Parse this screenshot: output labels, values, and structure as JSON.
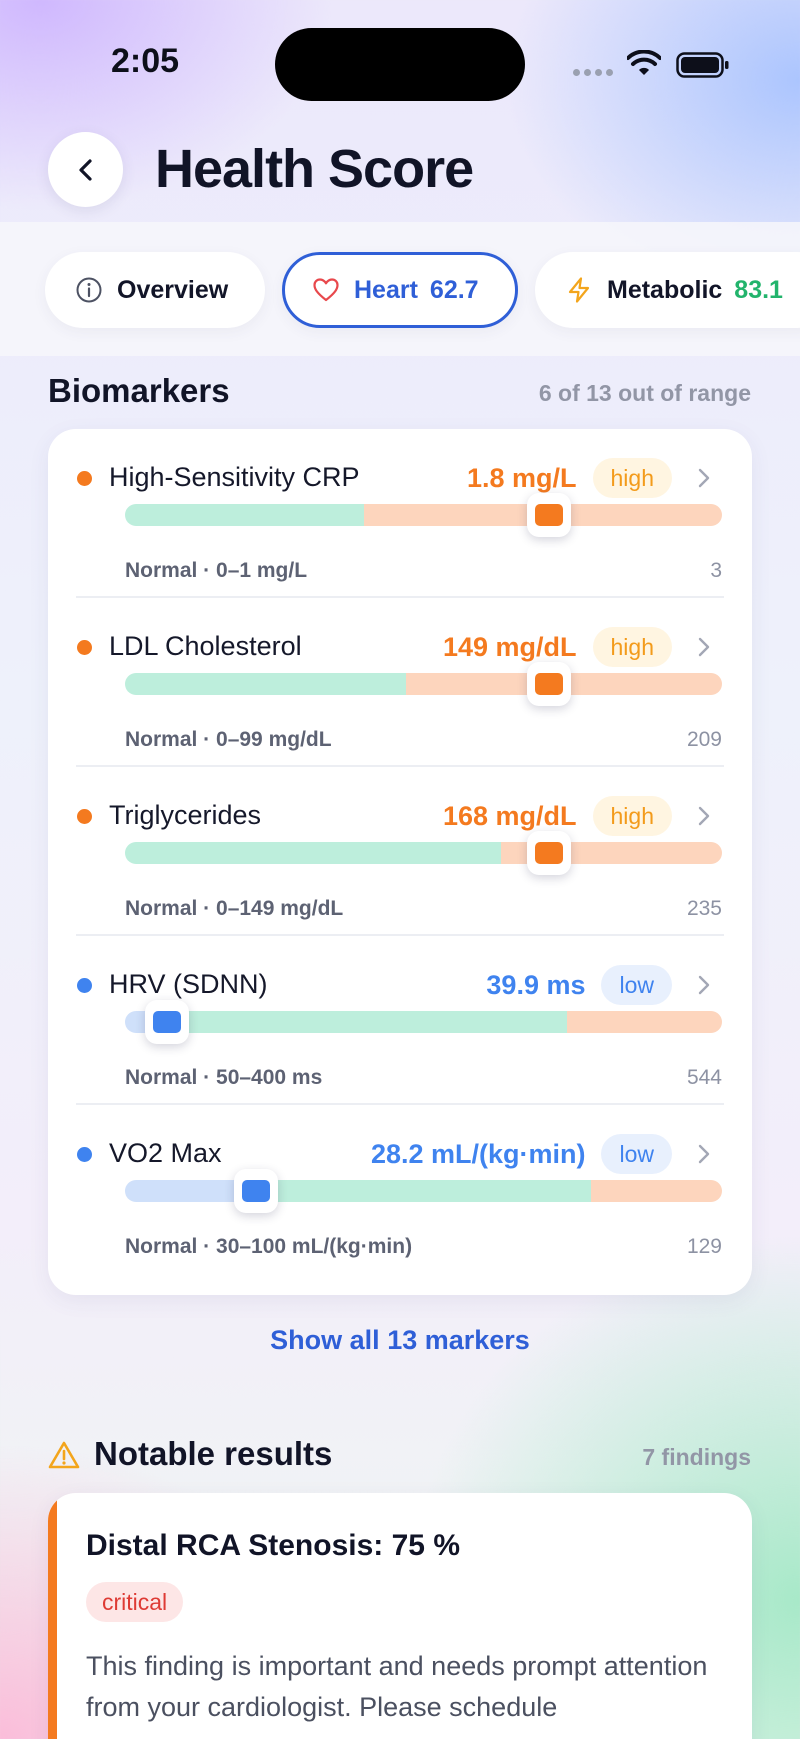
{
  "status_bar": {
    "time": "2:05"
  },
  "header": {
    "title": "Health Score"
  },
  "tabs": [
    {
      "label": "Overview",
      "icon": "info-icon",
      "score": ""
    },
    {
      "label": "Heart",
      "icon": "heart-icon",
      "score": "62.7",
      "selected": true
    },
    {
      "label": "Metabolic",
      "icon": "bolt-icon",
      "score": "83.1"
    }
  ],
  "biomarkers": {
    "title": "Biomarkers",
    "meta": "6 of 13 out of range",
    "items": [
      {
        "name": "High-Sensitivity CRP",
        "value": "1.8 mg/L",
        "status": "high",
        "range": "Normal · 0–1 mg/L",
        "max": "3",
        "normal_end_pct": 40,
        "marker_pct": 71
      },
      {
        "name": "LDL Cholesterol",
        "value": "149 mg/dL",
        "status": "high",
        "range": "Normal · 0–99 mg/dL",
        "max": "209",
        "normal_end_pct": 47,
        "marker_pct": 71
      },
      {
        "name": "Triglycerides",
        "value": "168 mg/dL",
        "status": "high",
        "range": "Normal · 0–149 mg/dL",
        "max": "235",
        "normal_end_pct": 63,
        "marker_pct": 71
      },
      {
        "name": "HRV (SDNN)",
        "value": "39.9 ms",
        "status": "low",
        "range": "Normal · 50–400 ms",
        "max": "544",
        "normal_start_pct": 9,
        "normal_end_pct": 74,
        "marker_pct": 7
      },
      {
        "name": "VO2 Max",
        "value": "28.2 mL/(kg·min)",
        "status": "low",
        "range": "Normal · 30–100 mL/(kg·min)",
        "max": "129",
        "normal_start_pct": 23,
        "normal_end_pct": 78,
        "marker_pct": 22
      }
    ],
    "show_all": "Show all 13 markers"
  },
  "notable": {
    "title": "Notable results",
    "meta": "7 findings",
    "finding": {
      "title": "Distal RCA Stenosis: 75 %",
      "severity": "critical",
      "text": "This finding is important and needs prompt attention from your cardiologist. Please schedule"
    }
  },
  "colors": {
    "accent": "#2f5fd7",
    "high": "#f47a1f",
    "low": "#3f83ef",
    "good": "#22b46c",
    "critical": "#de3b35"
  }
}
